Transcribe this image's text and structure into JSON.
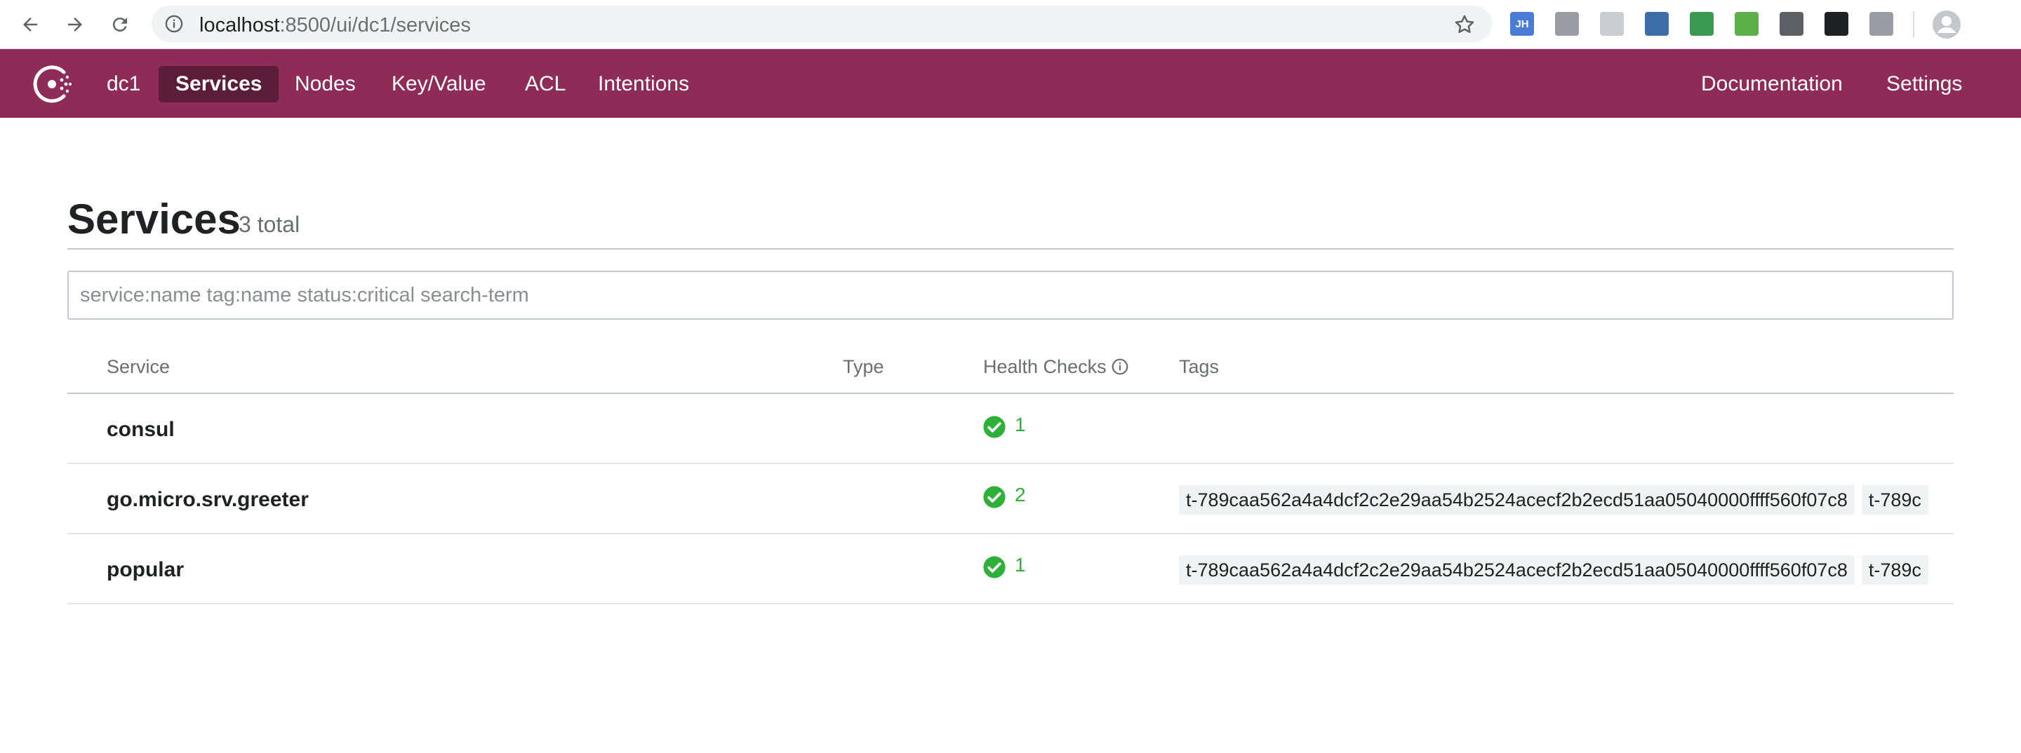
{
  "browser": {
    "url_host": "localhost",
    "url_rest": ":8500/ui/dc1/services",
    "extensions": [
      {
        "name": "jh-extension-icon",
        "label": "JH",
        "color": "#4a7bd6"
      },
      {
        "name": "bolt-extension-icon",
        "label": "",
        "color": "#9a9ea4"
      },
      {
        "name": "react-extension-icon",
        "label": "",
        "color": "#c9ccd1"
      },
      {
        "name": "graph-extension-icon",
        "label": "",
        "color": "#3c6fa8"
      },
      {
        "name": "vue-search-extension-icon",
        "label": "",
        "color": "#3a9a52"
      },
      {
        "name": "hex-extension-icon",
        "label": "",
        "color": "#5bb04a"
      },
      {
        "name": "v-extension-icon",
        "label": "",
        "color": "#5d6166"
      },
      {
        "name": "page-search-extension-icon",
        "label": "",
        "color": "#202124"
      },
      {
        "name": "tree-extension-icon",
        "label": "",
        "color": "#9a9ea4"
      }
    ]
  },
  "header": {
    "datacenter": "dc1",
    "nav": {
      "services": "Services",
      "nodes": "Nodes",
      "kv": "Key/Value",
      "acl": "ACL",
      "intentions": "Intentions"
    },
    "right": {
      "documentation": "Documentation",
      "settings": "Settings"
    },
    "brand_color": "#8e2c57"
  },
  "page": {
    "title": "Services",
    "count": "3 total"
  },
  "search": {
    "placeholder": "service:name tag:name status:critical search-term",
    "value": ""
  },
  "table": {
    "columns": {
      "service": "Service",
      "type": "Type",
      "health": "Health Checks",
      "tags": "Tags"
    },
    "rows": [
      {
        "name": "consul",
        "type": "",
        "health": "1",
        "tags": []
      },
      {
        "name": "go.micro.srv.greeter",
        "type": "",
        "health": "2",
        "tags": [
          "t-789caa562a4a4dcf2c2e29aa54b2524acecf2b2ecd51aa05040000ffff560f07c8",
          "t-789c"
        ]
      },
      {
        "name": "popular",
        "type": "",
        "health": "1",
        "tags": [
          "t-789caa562a4a4dcf2c2e29aa54b2524acecf2b2ecd51aa05040000ffff560f07c8",
          "t-789c"
        ]
      }
    ]
  }
}
